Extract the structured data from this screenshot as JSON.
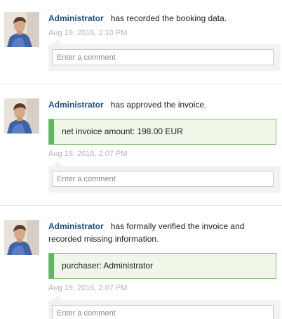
{
  "entries": [
    {
      "user": "Administrator",
      "action": "has recorded the booking data.",
      "timestamp": "Aug 19, 2016, 2:10 PM",
      "comment_placeholder": "Enter a comment"
    },
    {
      "user": "Administrator",
      "action": "has approved the invoice.",
      "detail": "net invoice amount: 198.00 EUR",
      "timestamp": "Aug 19, 2016, 2:07 PM",
      "comment_placeholder": "Enter a comment"
    },
    {
      "user": "Administrator",
      "action": "has formally verified the invoice and recorded missing information.",
      "detail": "purchaser: Administrator",
      "timestamp": "Aug 19, 2016, 2:07 PM",
      "comment_placeholder": "Enter a comment"
    }
  ],
  "colors": {
    "user_link": "#1f4e79",
    "timestamp": "#b5b5b5",
    "detail_bg": "#eef7e8",
    "detail_bar": "#5cb85c",
    "comment_area": "#f2f2f2"
  }
}
